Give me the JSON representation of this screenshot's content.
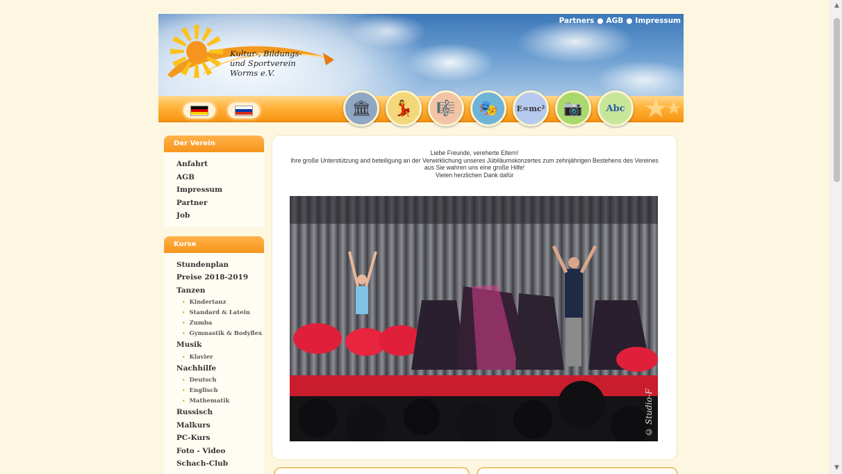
{
  "header": {
    "logo_line1": "Kultur-, Bildungs-",
    "logo_line2": "und Sportverein",
    "logo_line3": "Worms e.V.",
    "top_links": [
      "Partners",
      "AGB",
      "Impressum"
    ]
  },
  "languages": [
    {
      "name": "german-flag",
      "colors": [
        "#000000",
        "#dd0000",
        "#ffce00"
      ]
    },
    {
      "name": "russian-flag",
      "colors": [
        "#ffffff",
        "#0039a6",
        "#d52b1e"
      ]
    }
  ],
  "nav_icons": [
    {
      "name": "city-icon",
      "glyph": "🏛",
      "bg": "#8fa6c4"
    },
    {
      "name": "dance-icon",
      "glyph": "💃",
      "bg": "#f3d77b"
    },
    {
      "name": "music-icon",
      "glyph": "🎼",
      "bg": "#f2c3a4"
    },
    {
      "name": "theater-masks-icon",
      "glyph": "🎭",
      "bg": "#6fb3d9"
    },
    {
      "name": "education-icon",
      "glyph": "E=mc²",
      "bg": "#b6c9ef"
    },
    {
      "name": "photo-video-icon",
      "glyph": "📷",
      "bg": "#a9d86c"
    },
    {
      "name": "alphabet-icon",
      "glyph": "Abc",
      "bg": "#c7e69a"
    }
  ],
  "sidebar": {
    "verein_title": "Der Verein",
    "verein_items": [
      "Anfahrt",
      "AGB",
      "Impressum",
      "Partner",
      "Job"
    ],
    "kurse_title": "Kurse",
    "kurse_items": [
      {
        "label": "Stundenplan",
        "type": "item"
      },
      {
        "label": "Preise 2018-2019",
        "type": "item"
      },
      {
        "label": "Tanzen",
        "type": "item"
      },
      {
        "label": "Kindertanz",
        "type": "sub"
      },
      {
        "label": "Standard & Latein",
        "type": "sub"
      },
      {
        "label": "Zumba",
        "type": "sub"
      },
      {
        "label": "Gymnastik & Bodyflex",
        "type": "sub"
      },
      {
        "label": "Musik",
        "type": "item"
      },
      {
        "label": "Klavier",
        "type": "sub"
      },
      {
        "label": "Nachhilfe",
        "type": "item"
      },
      {
        "label": "Deutsch",
        "type": "sub"
      },
      {
        "label": "Englisch",
        "type": "sub"
      },
      {
        "label": "Mathematik",
        "type": "sub"
      },
      {
        "label": "Russisch",
        "type": "item"
      },
      {
        "label": "Malkurs",
        "type": "item"
      },
      {
        "label": "PC-Kurs",
        "type": "item"
      },
      {
        "label": "Foto - Video",
        "type": "item"
      },
      {
        "label": "Schach-Club",
        "type": "item"
      }
    ]
  },
  "main": {
    "message_line1": "Liebe Freunde, vereherte Eltern!",
    "message_line2": "Ihre große Unterstützung and beteiligung an der Verwirklichung unseres Jübiläumskonzertes zum zehnjährigen Bestehens des Vereines aus Sie wahren uns eine große Hilfe!",
    "message_line3": "Vielen herzlichen Dank dafür",
    "photo_watermark": "© Studio-F"
  }
}
